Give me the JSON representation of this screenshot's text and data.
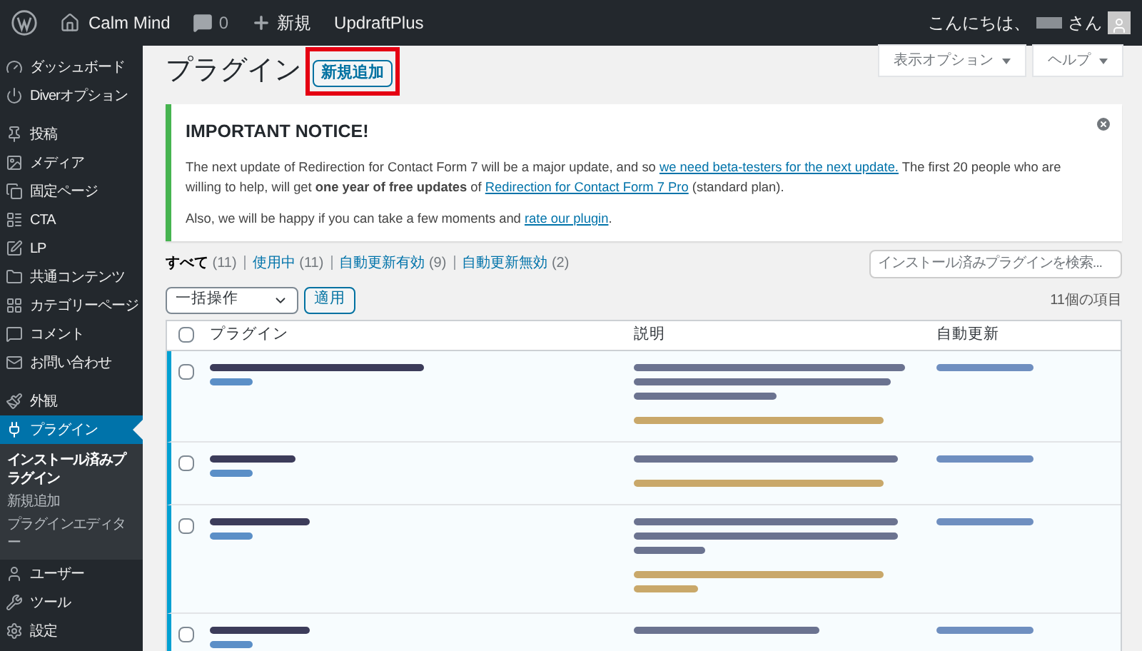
{
  "admin_bar": {
    "site": "Calm Mind",
    "comments": "0",
    "new": "新規",
    "plugin": "UpdraftPlus",
    "greeting": "こんにちは、",
    "honorific": "さん"
  },
  "screen_meta": {
    "options": "表示オプション",
    "help": "ヘルプ"
  },
  "sidebar": {
    "groups": [
      [
        {
          "label": "ダッシュボード",
          "selected": false
        },
        {
          "label": "Diverオプション",
          "selected": false
        }
      ],
      [
        {
          "label": "投稿",
          "selected": false
        },
        {
          "label": "メディア",
          "selected": false
        },
        {
          "label": "固定ページ",
          "selected": false
        },
        {
          "label": "CTA",
          "selected": false
        },
        {
          "label": "LP",
          "selected": false
        },
        {
          "label": "共通コンテンツ",
          "selected": false
        },
        {
          "label": "カテゴリーページ",
          "selected": false
        },
        {
          "label": "コメント",
          "selected": false
        },
        {
          "label": "お問い合わせ",
          "selected": false
        }
      ],
      [
        {
          "label": "外観",
          "selected": false
        },
        {
          "label": "プラグイン",
          "selected": true,
          "children": [
            {
              "label": "インストール済みプラグイン",
              "selected": true
            },
            {
              "label": "新規追加",
              "selected": false
            },
            {
              "label": "プラグインエディター",
              "selected": false
            }
          ]
        },
        {
          "label": "ユーザー",
          "selected": false
        },
        {
          "label": "ツール",
          "selected": false
        },
        {
          "label": "設定",
          "selected": false
        }
      ]
    ]
  },
  "page_title": "プラグイン",
  "add_new_button": {
    "label": "新規追加",
    "highlighted": true
  },
  "notice": {
    "title": "IMPORTANT NOTICE!",
    "dismissible": true,
    "paragraphs": [
      [
        {
          "kind": "text",
          "text": "The next update of Redirection for Contact Form 7 will be a major update, and so "
        },
        {
          "kind": "link",
          "text": "we need beta-testers for the next update."
        },
        {
          "kind": "text",
          "text": " The first 20 people who are willing to help, will get "
        },
        {
          "kind": "bold",
          "text": "one year of free updates"
        },
        {
          "kind": "text",
          "text": " of "
        },
        {
          "kind": "link",
          "text": "Redirection for Contact Form 7 Pro"
        },
        {
          "kind": "text",
          "text": " (standard plan)."
        }
      ],
      [
        {
          "kind": "text",
          "text": "Also, we will be happy if you can take a few moments and "
        },
        {
          "kind": "link",
          "text": "rate our plugin"
        },
        {
          "kind": "text",
          "text": "."
        }
      ]
    ]
  },
  "filters": [
    {
      "label": "すべて",
      "count": "(11)",
      "selected": true
    },
    {
      "label": "使用中",
      "count": "(11)",
      "selected": false
    },
    {
      "label": "自動更新有効",
      "count": "(9)",
      "selected": false
    },
    {
      "label": "自動更新無効",
      "count": "(2)",
      "selected": false
    }
  ],
  "search": {
    "placeholder": "インストール済みプラグインを検索..."
  },
  "bulk_action": {
    "value": "一括操作"
  },
  "apply_button": "適用",
  "item_count": "11個の項目",
  "table": {
    "select_all_checked": false,
    "columns": [
      "プラグイン",
      "説明",
      "自動更新"
    ],
    "rows": [
      {
        "active": true,
        "checked": false
      },
      {
        "active": true,
        "checked": false
      },
      {
        "active": true,
        "checked": false
      },
      {
        "active": true,
        "checked": false
      }
    ]
  }
}
